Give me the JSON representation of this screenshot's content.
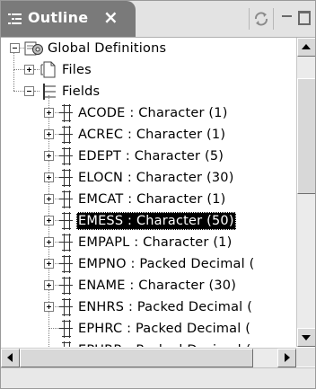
{
  "view": {
    "title": "Outline",
    "close_icon": "×",
    "sync_icon": "link-with-editor-icon",
    "minimize_icon": "minimize-icon",
    "maximize_icon": "maximize-icon"
  },
  "tree": {
    "root": {
      "label": "Global Definitions",
      "expanded": true,
      "icon": "global-definitions-icon"
    },
    "files": {
      "label": "Files",
      "expanded": false,
      "icon": "files-icon"
    },
    "fields": {
      "label": "Fields",
      "expanded": true,
      "icon": "fields-icon"
    },
    "field_items": [
      {
        "label": "ACODE : Character (1)",
        "expandable": true,
        "selected": false
      },
      {
        "label": "ACREC : Character (1)",
        "expandable": true,
        "selected": false
      },
      {
        "label": "EDEPT : Character (5)",
        "expandable": true,
        "selected": false
      },
      {
        "label": "ELOCN : Character (30)",
        "expandable": true,
        "selected": false
      },
      {
        "label": "EMCAT : Character (1)",
        "expandable": true,
        "selected": false
      },
      {
        "label": "EMESS : Character (50)",
        "expandable": true,
        "selected": true
      },
      {
        "label": "EMPAPL : Character (1)",
        "expandable": true,
        "selected": false
      },
      {
        "label": "EMPNO : Packed Decimal (",
        "expandable": true,
        "selected": false
      },
      {
        "label": "ENAME : Character (30)",
        "expandable": true,
        "selected": false
      },
      {
        "label": "ENHRS : Packed Decimal (",
        "expandable": true,
        "selected": false
      },
      {
        "label": "EPHRC : Packed Decimal (",
        "expandable": false,
        "selected": false
      },
      {
        "label": "EPURR : Packed Decimal (",
        "expandable": false,
        "selected": false
      }
    ]
  },
  "scrollbars": {
    "vertical_position": 0.08,
    "vertical_extent": 0.42,
    "horizontal_position": 0.0,
    "horizontal_extent": 0.9
  },
  "colors": {
    "tab_active": "#7a7a7a",
    "selection": "#000000",
    "header_bg": "#e3e3e3"
  }
}
